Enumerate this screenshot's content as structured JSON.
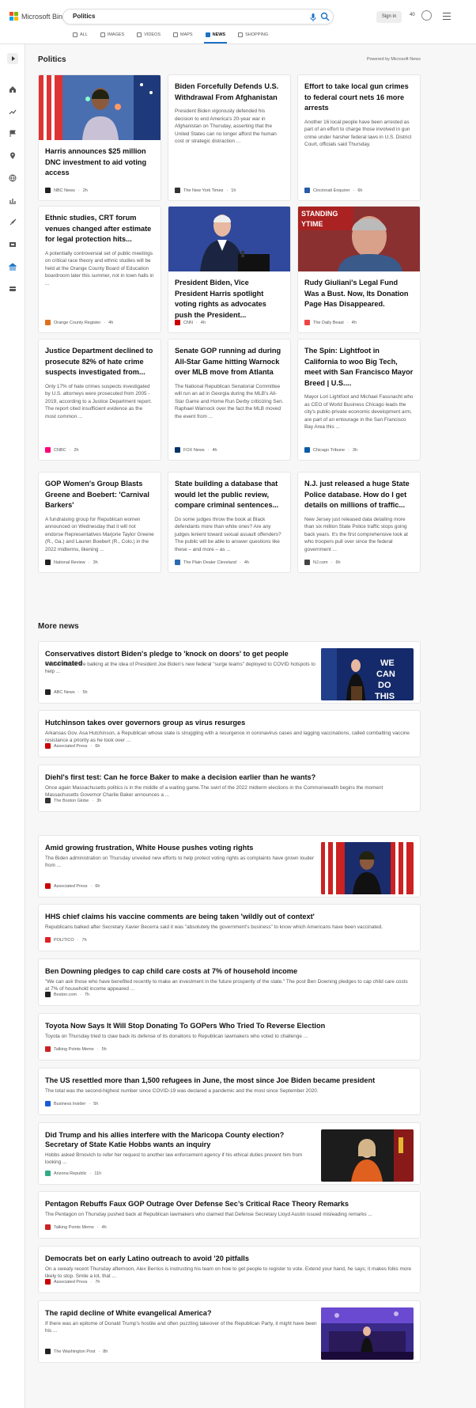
{
  "header": {
    "brand": "Microsoft Bing",
    "query": "Politics",
    "signin": "Sign in",
    "points": "40",
    "tabs": [
      {
        "label": "ALL",
        "icon": "search-icon"
      },
      {
        "label": "IMAGES",
        "icon": "image-icon"
      },
      {
        "label": "VIDEOS",
        "icon": "video-icon"
      },
      {
        "label": "MAPS",
        "icon": "map-pin-icon"
      },
      {
        "label": "NEWS",
        "icon": "news-icon",
        "active": true
      },
      {
        "label": "SHOPPING",
        "icon": "shopping-bag-icon"
      }
    ]
  },
  "sidebar": {
    "icons": [
      "chevron-right-icon",
      "home-icon",
      "trending-icon",
      "flag-icon",
      "location-pin-icon",
      "globe-icon",
      "chart-icon",
      "rocket-icon",
      "film-icon",
      "bank-icon",
      "card-icon"
    ]
  },
  "section": {
    "title": "Politics",
    "powered": "Powered by Microsoft News"
  },
  "cards": [
    {
      "title": "Harris announces $25 million DNC investment to aid voting access",
      "snippet": "",
      "source": "NBC News",
      "time": "2h",
      "image": true,
      "color": "#222"
    },
    {
      "title": "Biden Forcefully Defends U.S. Withdrawal From Afghanistan",
      "snippet": "President Biden vigorously defended his decision to end America’s 20-year war in Afghanistan on Thursday, asserting that the United States can no longer afford the human cost or strategic distraction ...",
      "source": "The New York Times",
      "time": "1h",
      "image": false,
      "color": "#333"
    },
    {
      "title": "Effort to take local gun crimes to federal court nets 16 more arrests",
      "snippet": "Another 16 local people have been arrested as part of an effort to charge those involved in gun crime under harsher federal laws in U.S. District Court, officials said Thursday.",
      "source": "Cincinnati Enquirer",
      "time": "6h",
      "image": false,
      "color": "#2a5aa8"
    },
    {
      "title": "Ethnic studies, CRT forum venues changed after estimate for legal protection hits...",
      "snippet": "A potentially controversial set of public meetings on critical race theory and ethnic studies will be held at the Orange County Board of Education boardroom later this summer, not in town halls in ...",
      "source": "Orange County Register",
      "time": "4h",
      "image": false,
      "color": "#e07020"
    },
    {
      "title": "President Biden, Vice President Harris spotlight voting rights as advocates push the President...",
      "snippet": "",
      "source": "CNN",
      "time": "4h",
      "image": true,
      "color": "#cc0000"
    },
    {
      "title": "Rudy Giuliani's Legal Fund Was a Bust. Now, Its Donation Page Has Disappeared.",
      "snippet": "",
      "source": "The Daily Beast",
      "time": "4h",
      "image": true,
      "color": "#e44"
    },
    {
      "title": "Justice Department declined to prosecute 82% of hate crime suspects investigated from...",
      "snippet": "Only 17% of hate crimes suspects investigated by U.S. attorneys were prosecuted from 2005 - 2019, according to a Justice Department report. The report cited insufficient evidence as the most common ...",
      "source": "CNBC",
      "time": "2h",
      "image": false,
      "color": "#f07"
    },
    {
      "title": "Senate GOP running ad during All-Star Game hitting Warnock over MLB move from Atlanta",
      "snippet": "The National Republican Senatorial Committee will run an ad in Georgia during the MLB's All-Star Game and Home Run Derby criticizing Sen. Raphael Warnock over the fact the MLB moved the event from ...",
      "source": "FOX News",
      "time": "4h",
      "image": false,
      "color": "#003366"
    },
    {
      "title": "The Spin: Lightfoot in California to woo Big Tech, meet with San Francisco Mayor Breed | U.S....",
      "snippet": "Mayor Lori Lightfoot and Michael Fassnacht who as CEO of World Business Chicago leads the city's public-private economic development arm, are part of an entourage in the San Francisco Bay Area this ...",
      "source": "Chicago Tribune",
      "time": "3h",
      "image": false,
      "color": "#0a5ba8"
    },
    {
      "title": "GOP Women's Group Blasts Greene and Boebert: 'Carnival Barkers'",
      "snippet": "A fundraising group for Republican women announced on Wednesday that it will not endorse Representatives Marjorie Taylor Greene (R., Ga.) and Lauren Boebert (R., Colo.) in the 2022 midterms, likening ...",
      "source": "National Review",
      "time": "3h",
      "image": false,
      "color": "#222"
    },
    {
      "title": "State building a database that would let the public review, compare criminal sentences...",
      "snippet": "Do some judges throw the book at Black defendants more than white ones? Are any judges lenient toward sexual assault offenders? The public will be able to answer questions like these – and more – as ...",
      "source": "The Plain Dealer Cleveland",
      "time": "4h",
      "image": false,
      "color": "#2b6cb0"
    },
    {
      "title": "N.J. just released a huge State Police database. How do I get details on millions of traffic...",
      "snippet": "New Jersey just released data detailing more than six million State Police traffic stops going back years. It's the first comprehensive look at who troopers pull over since the federal government ...",
      "source": "NJ.com",
      "time": "6h",
      "image": false,
      "color": "#444"
    }
  ],
  "more": {
    "title": "More news",
    "items": [
      {
        "title": "Conservatives distort Biden's pledge to 'knock on doors' to get people vaccinated",
        "snippet": "Conservatives are balking at the idea of President Joe Biden's new federal \"surge teams\" deployed to COVID hotspots to help ...",
        "source": "ABC News",
        "time": "5h",
        "thumb": "we-can-do-this",
        "thumb_text": "WE CAN DO THIS",
        "color": "#222"
      },
      {
        "title": "Hutchinson takes over governors group as virus resurges",
        "snippet": "Arkansas Gov. Asa Hutchinson, a Republican whose state is struggling with a resurgence in coronavirus cases and lagging vaccinations, called combatting vaccine resistance a priority as he took over ...",
        "source": "Associated Press",
        "time": "6h",
        "color": "#c00"
      },
      {
        "title": "Diehl's first test: Can he force Baker to make a decision earlier than he wants?",
        "snippet": "Once again Massachusetts politics is in the middle of a waiting game.The swirl of the 2022 midterm elections in the Commonwealth begins the moment Massachusetts Governor Charlie Baker announces a ...",
        "source": "The Boston Globe",
        "time": "3h",
        "color": "#333"
      },
      {
        "title": "Amid growing frustration, White House pushes voting rights",
        "snippet": "The Biden administration on Thursday unveiled new efforts to help protect voting rights as complaints have grown louder from ...",
        "source": "Associated Press",
        "time": "6h",
        "thumb": "flags",
        "color": "#c00"
      },
      {
        "title": "HHS chief claims his vaccine comments are being taken 'wildly out of context'",
        "snippet": "Republicans balked after Secretary Xavier Becerra said it was \"absolutely the government's business\" to know which Americans have been vaccinated.",
        "source": "POLITICO",
        "time": "7h",
        "color": "#d22"
      },
      {
        "title": "Ben Downing pledges to cap child care costs at 7% of household income",
        "snippet": "\"We can ask those who have benefited recently to make an investment in the future prosperity of the state.\" The post Ben Downing pledges to cap child care costs at 7% of household income appeared ...",
        "source": "Boston.com",
        "time": "7h",
        "color": "#222"
      },
      {
        "title": "Toyota Now Says It Will Stop Donating To GOPers Who Tried To Reverse Election",
        "snippet": "Toyota on Thursday tried to claw back its defense of its donations to Republican lawmakers who voted to challenge ...",
        "source": "Talking Points Memo",
        "time": "5h",
        "color": "#c22"
      },
      {
        "title": "The US resettled more than 1,500 refugees in June, the most since Joe Biden became president",
        "snippet": "The total was the second-highest number since COVID-19 was declared a pandemic and the most since September 2020.",
        "source": "Business Insider",
        "time": "5h",
        "color": "#1a5bd8"
      },
      {
        "title": "Did Trump and his allies interfere with the Maricopa County election? Secretary of State Katie Hobbs wants an inquiry",
        "snippet": "Hobbs asked Brnovich to refer her request to another law enforcement agency if his ethical duties prevent him from looking ...",
        "source": "Arizona Republic",
        "time": "11h",
        "thumb": "hobbs",
        "color": "#3a8"
      },
      {
        "title": "Pentagon Rebuffs Faux GOP Outrage Over Defense Sec’s Critical Race Theory Remarks",
        "snippet": "The Pentagon on Thursday pushed back at Republican lawmakers who claimed that Defense Secretary Lloyd Austin issued misleading remarks ...",
        "source": "Talking Points Memo",
        "time": "4h",
        "color": "#c22"
      },
      {
        "title": "Democrats bet on early Latino outreach to avoid '20 pitfalls",
        "snippet": "On a sweaty recent Thursday afternoon, Alex Berrios is instructing his team on how to get people to register to vote. Extend your hand, he says; it makes folks more likely to stop. Smile a lot, that ...",
        "source": "Associated Press",
        "time": "7h",
        "color": "#c00"
      },
      {
        "title": "The rapid decline of White evangelical America?",
        "snippet": "If there was an epitome of Donald Trump's hostile and often puzzling takeover of the Republican Party, it might have been his ...",
        "source": "The Washington Post",
        "time": "8h",
        "thumb": "stage",
        "color": "#222"
      }
    ]
  }
}
